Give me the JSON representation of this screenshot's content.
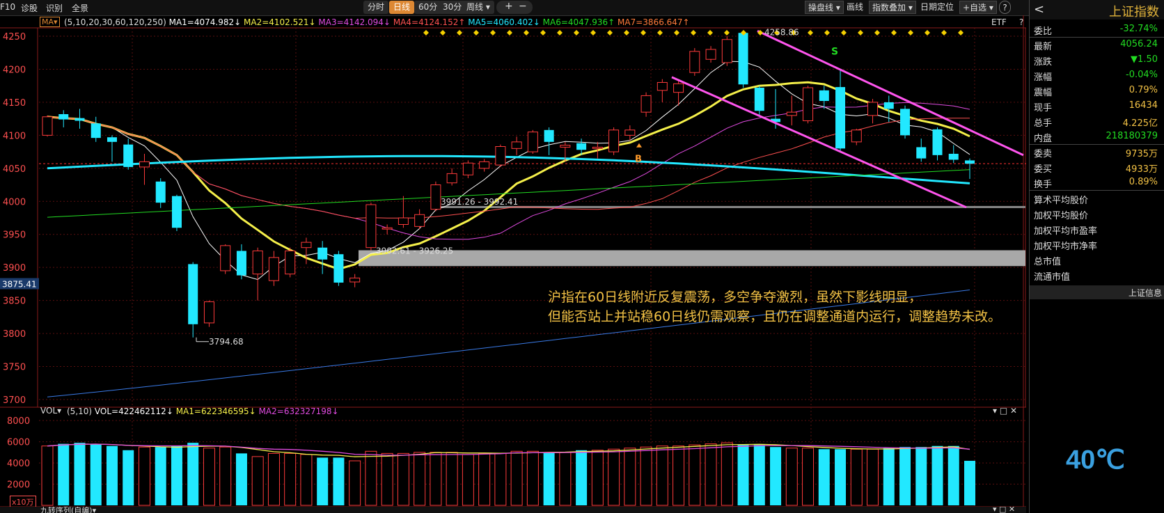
{
  "toolbar": {
    "left": [
      "F10",
      "诊股",
      "识别",
      "全景"
    ],
    "periods": [
      "分时",
      "日线",
      "60分",
      "30分",
      "周线 ▾"
    ],
    "active_period": "日线",
    "zoom": [
      "+",
      "−"
    ],
    "right": [
      "操盘线 ▾",
      "画线",
      "指数叠加 ▾",
      "日期定位",
      "+自选 ▾",
      "?"
    ]
  },
  "indicator": {
    "ma_tag": "MA▾",
    "params": "(5,10,20,30,60,120,250)",
    "ma": [
      {
        "label": "MA1=4074.982↓",
        "color": "#ffffff"
      },
      {
        "label": "MA2=4102.521↓",
        "color": "#f5f04a"
      },
      {
        "label": "MA3=4142.094↓",
        "color": "#e04be0"
      },
      {
        "label": "MA4=4124.152↑",
        "color": "#ff5050"
      },
      {
        "label": "MA5=4060.402↓",
        "color": "#22e8ff"
      },
      {
        "label": "MA6=4047.936↑",
        "color": "#22dd22"
      },
      {
        "label": "MA7=3866.647↑",
        "color": "#3a7be8"
      }
    ],
    "etf": "ETF",
    "help": "?"
  },
  "price_axis": {
    "labels": [
      "4250",
      "4200",
      "4150",
      "4100",
      "4050",
      "4000",
      "3950",
      "3900",
      "3850",
      "3800",
      "3750",
      "3700"
    ],
    "min": 3700,
    "max": 4250,
    "current": "3875.41"
  },
  "annotations": {
    "peak": "4258.86",
    "low": "3794.68",
    "box1": "3902.61 - 3926.25",
    "box2": "3991.26 - 3992.41",
    "buy": "B",
    "sell": "S"
  },
  "note": {
    "line1": "沪指在60日线附近反复震荡，多空争夺激烈，虽然下影线明显，",
    "line2": "但能否站上并站稳60日线仍需观察，且仍在调整通道内运行，调整趋势未改。"
  },
  "volume": {
    "header_params": "(5,10)",
    "header_vol": "VOL=422462112↓",
    "header_ma1": "MA1=622346595↓",
    "header_ma2": "MA2=632327198↓",
    "tag": "VOL▾",
    "axis": [
      "8000",
      "6000",
      "4000",
      "2000"
    ],
    "unit": "x10万",
    "controls": "▾ □ ✕"
  },
  "bottom_bar": {
    "label": "九转序列(自编)▾",
    "controls": "▾ □ ✕"
  },
  "candles": [
    {
      "o": 4100,
      "c": 4128,
      "h": 4130,
      "l": 4098
    },
    {
      "o": 4132,
      "c": 4124,
      "h": 4138,
      "l": 4112
    },
    {
      "o": 4126,
      "c": 4122,
      "h": 4140,
      "l": 4110
    },
    {
      "o": 4118,
      "c": 4096,
      "h": 4128,
      "l": 4090
    },
    {
      "o": 4097,
      "c": 4090,
      "h": 4100,
      "l": 4060
    },
    {
      "o": 4086,
      "c": 4052,
      "h": 4095,
      "l": 4048
    },
    {
      "o": 4052,
      "c": 4060,
      "h": 4072,
      "l": 4025
    },
    {
      "o": 4030,
      "c": 3998,
      "h": 4035,
      "l": 3990
    },
    {
      "o": 4008,
      "c": 3960,
      "h": 4010,
      "l": 3955
    },
    {
      "o": 3905,
      "c": 3814,
      "h": 3908,
      "l": 3794
    },
    {
      "o": 3816,
      "c": 3848,
      "h": 3850,
      "l": 3810
    },
    {
      "o": 3895,
      "c": 3933,
      "h": 3935,
      "l": 3890
    },
    {
      "o": 3925,
      "c": 3888,
      "h": 3935,
      "l": 3882
    },
    {
      "o": 3890,
      "c": 3925,
      "h": 3930,
      "l": 3850
    },
    {
      "o": 3880,
      "c": 3915,
      "h": 3925,
      "l": 3872
    },
    {
      "o": 3890,
      "c": 3925,
      "h": 3930,
      "l": 3885
    },
    {
      "o": 3930,
      "c": 3938,
      "h": 3945,
      "l": 3905
    },
    {
      "o": 3930,
      "c": 3912,
      "h": 3940,
      "l": 3890
    },
    {
      "o": 3920,
      "c": 3877,
      "h": 3925,
      "l": 3872
    },
    {
      "o": 3878,
      "c": 3884,
      "h": 3890,
      "l": 3870
    },
    {
      "o": 3930,
      "c": 3995,
      "h": 3998,
      "l": 3926
    },
    {
      "o": 3958,
      "c": 3960,
      "h": 3965,
      "l": 3950
    },
    {
      "o": 3965,
      "c": 3975,
      "h": 4008,
      "l": 3960
    },
    {
      "o": 3962,
      "c": 3980,
      "h": 3988,
      "l": 3958
    },
    {
      "o": 3988,
      "c": 4025,
      "h": 4030,
      "l": 3985
    },
    {
      "o": 4028,
      "c": 4042,
      "h": 4050,
      "l": 4024
    },
    {
      "o": 4040,
      "c": 4058,
      "h": 4062,
      "l": 4035
    },
    {
      "o": 4050,
      "c": 4060,
      "h": 4064,
      "l": 4045
    },
    {
      "o": 4055,
      "c": 4083,
      "h": 4086,
      "l": 4052
    },
    {
      "o": 4080,
      "c": 4090,
      "h": 4098,
      "l": 4070
    },
    {
      "o": 4075,
      "c": 4105,
      "h": 4108,
      "l": 4072
    },
    {
      "o": 4108,
      "c": 4090,
      "h": 4112,
      "l": 4070
    },
    {
      "o": 4082,
      "c": 4085,
      "h": 4090,
      "l": 4060
    },
    {
      "o": 4088,
      "c": 4078,
      "h": 4095,
      "l": 4070
    },
    {
      "o": 4080,
      "c": 4082,
      "h": 4090,
      "l": 4065
    },
    {
      "o": 4075,
      "c": 4108,
      "h": 4112,
      "l": 4070
    },
    {
      "o": 4100,
      "c": 4108,
      "h": 4115,
      "l": 4092
    },
    {
      "o": 4135,
      "c": 4160,
      "h": 4165,
      "l": 4128
    },
    {
      "o": 4168,
      "c": 4180,
      "h": 4185,
      "l": 4150
    },
    {
      "o": 4165,
      "c": 4178,
      "h": 4182,
      "l": 4145
    },
    {
      "o": 4195,
      "c": 4227,
      "h": 4232,
      "l": 4190
    },
    {
      "o": 4215,
      "c": 4230,
      "h": 4235,
      "l": 4210
    },
    {
      "o": 4210,
      "c": 4245,
      "h": 4250,
      "l": 4205
    },
    {
      "o": 4255,
      "c": 4177,
      "h": 4258,
      "l": 4172
    },
    {
      "o": 4172,
      "c": 4137,
      "h": 4175,
      "l": 4130
    },
    {
      "o": 4125,
      "c": 4120,
      "h": 4170,
      "l": 4110
    },
    {
      "o": 4130,
      "c": 4135,
      "h": 4160,
      "l": 4115
    },
    {
      "o": 4122,
      "c": 4172,
      "h": 4175,
      "l": 4118
    },
    {
      "o": 4168,
      "c": 4152,
      "h": 4175,
      "l": 4140
    },
    {
      "o": 4173,
      "c": 4080,
      "h": 4200,
      "l": 4076
    },
    {
      "o": 4090,
      "c": 4108,
      "h": 4110,
      "l": 4085
    },
    {
      "o": 4130,
      "c": 4150,
      "h": 4155,
      "l": 4118
    },
    {
      "o": 4150,
      "c": 4140,
      "h": 4160,
      "l": 4120
    },
    {
      "o": 4140,
      "c": 4100,
      "h": 4145,
      "l": 4095
    },
    {
      "o": 4082,
      "c": 4065,
      "h": 4095,
      "l": 4060
    },
    {
      "o": 4109,
      "c": 4070,
      "h": 4112,
      "l": 4062
    },
    {
      "o": 4072,
      "c": 4063,
      "h": 4085,
      "l": 4058
    },
    {
      "o": 4062,
      "c": 4057,
      "h": 4065,
      "l": 4034
    }
  ],
  "vol_values": [
    5600,
    5800,
    5900,
    5800,
    5600,
    5200,
    5500,
    5500,
    5600,
    5900,
    5400,
    5500,
    4900,
    4600,
    4900,
    4900,
    4800,
    4500,
    4500,
    4200,
    5100,
    4900,
    4900,
    5000,
    5000,
    5000,
    4800,
    4900,
    4900,
    5100,
    5100,
    5000,
    5000,
    5200,
    5200,
    5300,
    5400,
    5500,
    5600,
    5600,
    5700,
    5800,
    5900,
    5700,
    5700,
    5500,
    5400,
    5400,
    5300,
    5300,
    5300,
    5300,
    5400,
    5500,
    5500,
    5600,
    5600,
    4200
  ],
  "right_panel": {
    "title": "上证指数",
    "back": "<",
    "quotes": [
      {
        "k": "委比",
        "v": "-32.74%",
        "c": "#22dd22"
      },
      {
        "k": "最新",
        "v": "4056.24",
        "c": "#22dd22"
      },
      {
        "k": "涨跌",
        "v": "▼1.50",
        "c": "#22dd22"
      },
      {
        "k": "涨幅",
        "v": "-0.04%",
        "c": "#22dd22"
      },
      {
        "k": "震幅",
        "v": "0.79%",
        "c": "#f3c245"
      },
      {
        "k": "现手",
        "v": "16434",
        "c": "#f3c245"
      },
      {
        "k": "总手",
        "v": "4.225亿",
        "c": "#f3c245"
      },
      {
        "k": "内盘",
        "v": "218180379",
        "c": "#22dd22"
      },
      {
        "k": "委卖",
        "v": "9735万",
        "c": "#f3c245"
      },
      {
        "k": "委买",
        "v": "4933万",
        "c": "#f3c245"
      },
      {
        "k": "换手",
        "v": "0.89%",
        "c": "#f3c245"
      }
    ],
    "items": [
      "算术平均股价",
      "加权平均股价",
      "加权平均市盈率",
      "加权平均市净率",
      "总市值",
      "流通市值"
    ],
    "info_bar": "上证信息",
    "temperature": "40℃"
  }
}
